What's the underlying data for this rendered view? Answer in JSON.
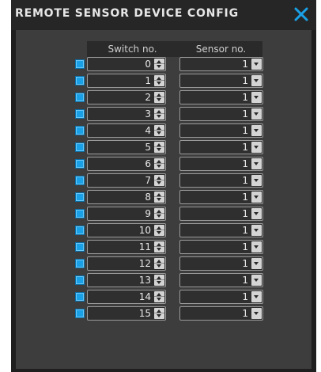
{
  "dialog": {
    "title": "REMOTE SENSOR DEVICE CONFIG",
    "close_icon": "close-x-icon",
    "accent_color": "#1aa0e6"
  },
  "table": {
    "headers": {
      "switch": "Switch no.",
      "sensor": "Sensor no."
    },
    "rows": [
      {
        "enabled": true,
        "switch": "0",
        "sensor": "1"
      },
      {
        "enabled": true,
        "switch": "1",
        "sensor": "1"
      },
      {
        "enabled": true,
        "switch": "2",
        "sensor": "1"
      },
      {
        "enabled": true,
        "switch": "3",
        "sensor": "1"
      },
      {
        "enabled": true,
        "switch": "4",
        "sensor": "1"
      },
      {
        "enabled": true,
        "switch": "5",
        "sensor": "1"
      },
      {
        "enabled": true,
        "switch": "6",
        "sensor": "1"
      },
      {
        "enabled": true,
        "switch": "7",
        "sensor": "1"
      },
      {
        "enabled": true,
        "switch": "8",
        "sensor": "1"
      },
      {
        "enabled": true,
        "switch": "9",
        "sensor": "1"
      },
      {
        "enabled": true,
        "switch": "10",
        "sensor": "1"
      },
      {
        "enabled": true,
        "switch": "11",
        "sensor": "1"
      },
      {
        "enabled": true,
        "switch": "12",
        "sensor": "1"
      },
      {
        "enabled": true,
        "switch": "13",
        "sensor": "1"
      },
      {
        "enabled": true,
        "switch": "14",
        "sensor": "1"
      },
      {
        "enabled": true,
        "switch": "15",
        "sensor": "1"
      }
    ]
  }
}
